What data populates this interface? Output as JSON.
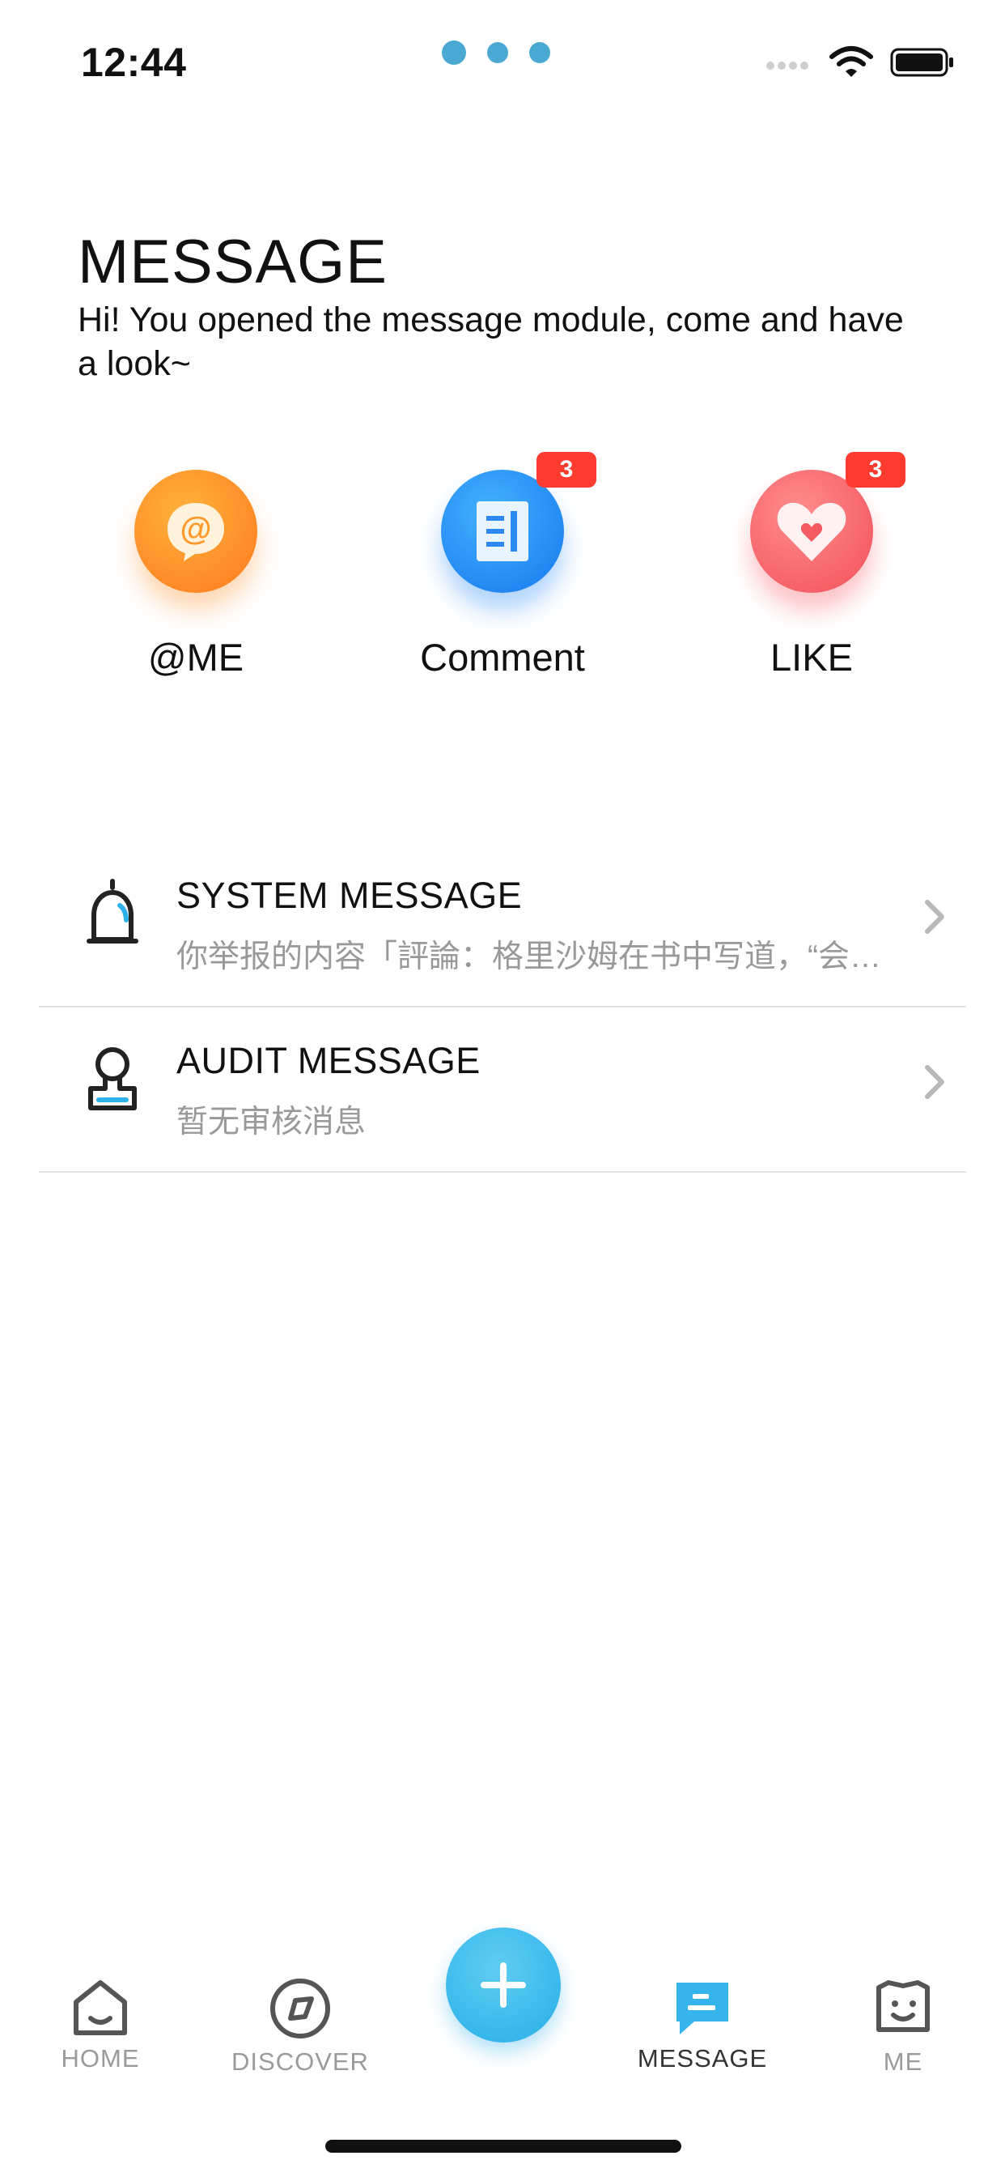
{
  "status_bar": {
    "time": "12:44"
  },
  "header": {
    "title": "MESSAGE",
    "subtitle": "Hi! You opened the message module, come and have a look~"
  },
  "quick_entries": [
    {
      "label": "@ME",
      "icon": "at-icon",
      "badge": ""
    },
    {
      "label": "Comment",
      "icon": "comment-icon",
      "badge": "3"
    },
    {
      "label": "LIKE",
      "icon": "heart-icon",
      "badge": "3"
    }
  ],
  "list": [
    {
      "title": "SYSTEM MESSAGE",
      "description": "你举报的内容「評論：格里沙姆在书中写道，“会…",
      "icon": "bell-icon"
    },
    {
      "title": "AUDIT MESSAGE",
      "description": "暂无审核消息",
      "icon": "stamp-icon"
    }
  ],
  "tabbar": {
    "items": [
      {
        "label": "HOME",
        "icon": "home-icon",
        "active": false
      },
      {
        "label": "DISCOVER",
        "icon": "compass-icon",
        "active": false
      },
      {
        "label": "MESSAGE",
        "icon": "message-icon",
        "active": true
      },
      {
        "label": "ME",
        "icon": "face-icon",
        "active": false
      }
    ],
    "fab_icon": "plus-icon"
  },
  "colors": {
    "accent": "#28aee8",
    "badge": "#ff3b2f",
    "orange": "#ff8a24",
    "blue": "#1e88f0",
    "red": "#f5565e"
  }
}
